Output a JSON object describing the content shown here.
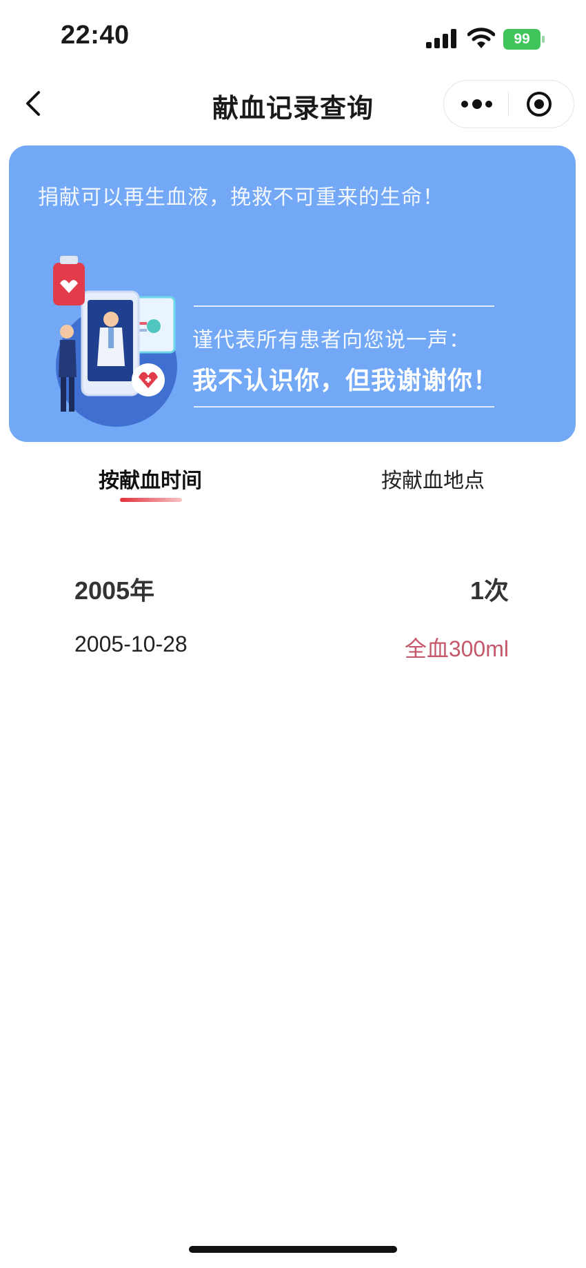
{
  "status_bar": {
    "time": "22:40",
    "battery_level": "99",
    "icons": [
      "signal-icon",
      "wifi-icon",
      "battery-charging-icon"
    ]
  },
  "nav": {
    "title": "献血记录查询",
    "back_icon": "chevron-left-icon",
    "more_icon": "more-dots-icon",
    "close_icon": "target-close-icon"
  },
  "banner": {
    "slogan": "捐献可以再生血液，挽救不可重来的生命！",
    "sub_line": "谨代表所有患者向您说一声：",
    "thanks_line": "我不认识你，但我谢谢你！",
    "illustration": "doctor-patient-blood-bag-illustration",
    "color": "#72a8f5"
  },
  "tabs": [
    {
      "label": "按献血时间",
      "active": true
    },
    {
      "label": "按献血地点",
      "active": false
    }
  ],
  "records": [
    {
      "year": "2005年",
      "count": "1次",
      "items": [
        {
          "date": "2005-10-28",
          "amount": "全血300ml"
        }
      ]
    }
  ],
  "colors": {
    "accent_red": "#e3303b",
    "amount_text": "#c5576b",
    "battery_green": "#3fc45a"
  }
}
